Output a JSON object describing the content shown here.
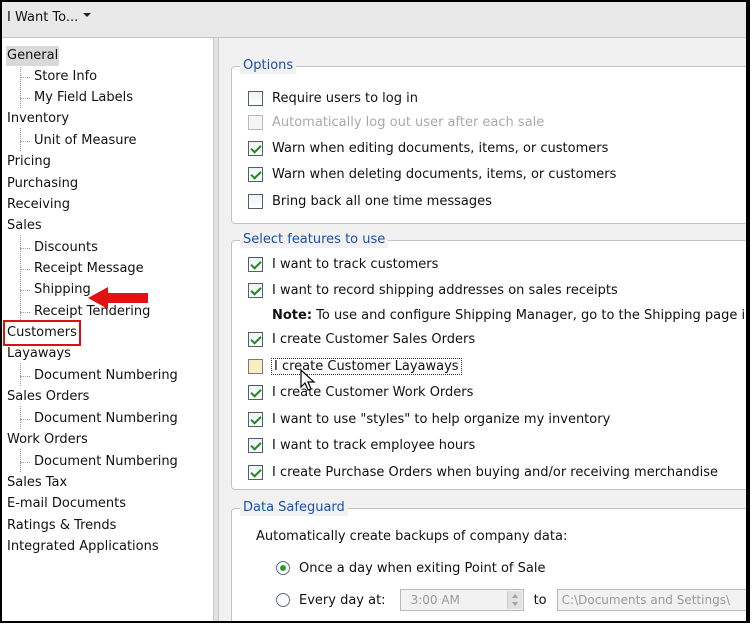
{
  "toolbar": {
    "i_want_to": "I Want To..."
  },
  "tree": {
    "general": "General",
    "store_info": "Store Info",
    "my_field_labels": "My Field Labels",
    "inventory": "Inventory",
    "unit_of_measure": "Unit of Measure",
    "pricing": "Pricing",
    "purchasing": "Purchasing",
    "receiving": "Receiving",
    "sales": "Sales",
    "discounts": "Discounts",
    "receipt_message": "Receipt Message",
    "shipping": "Shipping",
    "receipt_tendering": "Receipt Tendering",
    "customers": "Customers",
    "layaways": "Layaways",
    "layaways_doc_numbering": "Document Numbering",
    "sales_orders": "Sales Orders",
    "sales_orders_doc_numbering": "Document Numbering",
    "work_orders": "Work Orders",
    "work_orders_doc_numbering": "Document Numbering",
    "sales_tax": "Sales Tax",
    "email_documents": "E-mail Documents",
    "ratings_trends": "Ratings & Trends",
    "integrated_applications": "Integrated Applications"
  },
  "options": {
    "title": "Options",
    "items": [
      {
        "label": "Require users to log in",
        "checked": false,
        "disabled": false
      },
      {
        "label": "Automatically log out user after each sale",
        "checked": false,
        "disabled": true
      },
      {
        "label": "Warn when editing documents, items, or customers",
        "checked": true,
        "disabled": false
      },
      {
        "label": "Warn when deleting documents, items, or customers",
        "checked": true,
        "disabled": false
      },
      {
        "label": "Bring back all one time messages",
        "checked": false,
        "disabled": false
      }
    ]
  },
  "features": {
    "title": "Select features to use",
    "track_customers": "I want to track customers",
    "record_shipping": "I want to record shipping addresses on sales receipts",
    "note_label": "Note:",
    "note_text": " To use and configure Shipping Manager, go to the Shipping page in t",
    "customer_sales_orders": "I create Customer Sales Orders",
    "customer_layaways": "I create Customer Layaways",
    "customer_work_orders": "I create Customer Work Orders",
    "styles": "I want to use \"styles\" to help organize my inventory",
    "employee_hours": "I want to track employee hours",
    "purchase_orders": "I create Purchase Orders when buying and/or receiving merchandise"
  },
  "safeguard": {
    "title": "Data Safeguard",
    "description": "Automatically create backups of company data:",
    "once_a_day": "Once a day when exiting Point of Sale",
    "every_day_at": "Every day at:",
    "time_value": "3:00 AM",
    "to_label": "to",
    "path_value": "C:\\Documents and Settings\\"
  },
  "colors": {
    "highlight_red": "#d91111",
    "group_title_blue": "#1a4fa8",
    "check_green": "#1f8a1f"
  }
}
